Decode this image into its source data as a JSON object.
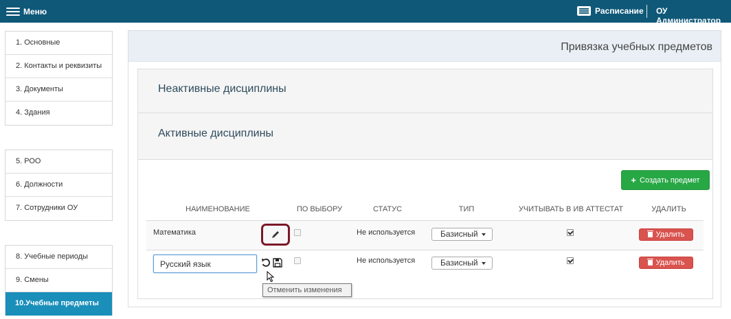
{
  "topbar": {
    "menu_label": "Меню",
    "menu_icon": "hamburger-icon",
    "schedule_label": "Расписание",
    "schedule_icon": "schedule-icon",
    "admin_label": "ОУ Администратор"
  },
  "sidebar": {
    "groups": [
      {
        "items": [
          {
            "label": "1.  Основные"
          },
          {
            "label": "2.  Контакты и реквизиты"
          },
          {
            "label": "3.  Документы"
          },
          {
            "label": "4.  Здания"
          }
        ]
      },
      {
        "items": [
          {
            "label": "5.  РОО"
          },
          {
            "label": "6.  Должности"
          },
          {
            "label": "7.  Сотрудники ОУ"
          }
        ]
      },
      {
        "items": [
          {
            "label": "8.  Учебные периоды"
          },
          {
            "label": "9.  Смены"
          },
          {
            "label": "10.Учебные предметы",
            "active": true
          }
        ]
      }
    ]
  },
  "main": {
    "title": "Привязка учебных предметов",
    "inactive_title": "Неактивные дисциплины",
    "active_title": "Активные дисциплины",
    "create_label": "Создать предмет",
    "columns": [
      "НАИМЕНОВАНИЕ",
      "ПО ВЫБОРУ",
      "СТАТУС",
      "ТИП",
      "УЧИТЫВАТЬ В ИВ АТТЕСТАТ",
      "УДАЛИТЬ"
    ],
    "rows": [
      {
        "name": "Математика",
        "optional": false,
        "status": "Не используется",
        "type": "Базисный",
        "in_certificate": true,
        "delete_label": "Удалить",
        "action_icon": "pencil-icon"
      },
      {
        "name": "Русский язык",
        "optional": false,
        "status": "Не используется",
        "type": "Базисный",
        "in_certificate": true,
        "delete_label": "Удалить",
        "action_icons": [
          "undo-icon",
          "save-icon"
        ]
      }
    ],
    "tooltip": "Отменить изменения"
  },
  "colors": {
    "topbar": "#0f5878",
    "sidebar_active": "#1a8fba",
    "create_button": "#28a745",
    "delete_button": "#d9534f",
    "highlight_border": "#7b1728"
  }
}
